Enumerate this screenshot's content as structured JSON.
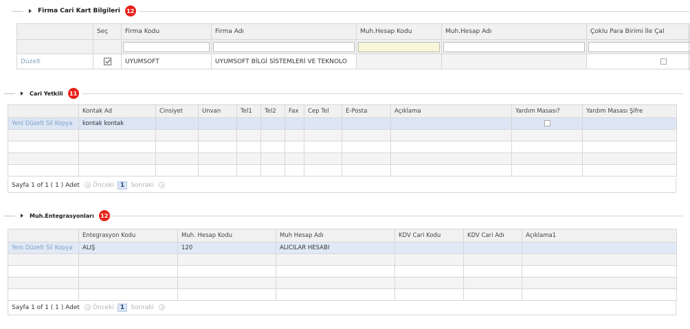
{
  "sections": {
    "firma": {
      "title": "Firma Cari Kart Bilgileri",
      "badge": "12"
    },
    "cari": {
      "title": "Cari Yetkili",
      "badge": "11"
    },
    "muh": {
      "title": "Muh.Entegrasyonları",
      "badge": "12"
    }
  },
  "firma_table": {
    "columns": [
      "",
      "Seç",
      "Firma Kodu",
      "Firma Adı",
      "Muh.Hesap Kodu",
      "Muh.Hesap Adı",
      "Çoklu Para Birimi İle Çal"
    ],
    "row": {
      "command": "Düzelt",
      "checked": true,
      "firma_kodu": "UYUMSOFT",
      "firma_adi": "UYUMSOFT BİLGİ SİSTEMLERİ VE TEKNOLO",
      "muh_hesap_kodu": "",
      "muh_hesap_adi": ""
    }
  },
  "cari_table": {
    "columns": [
      "",
      "Kontak Ad",
      "Cinsiyet",
      "Unvan",
      "Tel1",
      "Tel2",
      "Fax",
      "Cep Tel",
      "E-Posta",
      "Açıklama",
      "Yardım Masası?",
      "Yardım Masası Şifre"
    ],
    "row": {
      "command": "Yeni Düzelt Sil Kopya",
      "kontak_ad": "kontak kontak"
    }
  },
  "muh_table": {
    "columns": [
      "",
      "Entegrasyon Kodu",
      "Muh. Hesap Kodu",
      "Muh Hesap Adı",
      "KDV Cari Kodu",
      "KDV Cari Adı",
      "Açıklama1"
    ],
    "row": {
      "command": "Yeni Düzelt Sil Kopya",
      "entegrasyon_kodu": "ALIŞ",
      "muh_hesap_kodu": "120",
      "muh_hesap_adi": "ALICILAR HESABI"
    }
  },
  "pager": {
    "info": "Sayfa 1 of 1 ( 1 ) Adet",
    "prev": "Önceki",
    "page": "1",
    "next": "Sonraki"
  }
}
